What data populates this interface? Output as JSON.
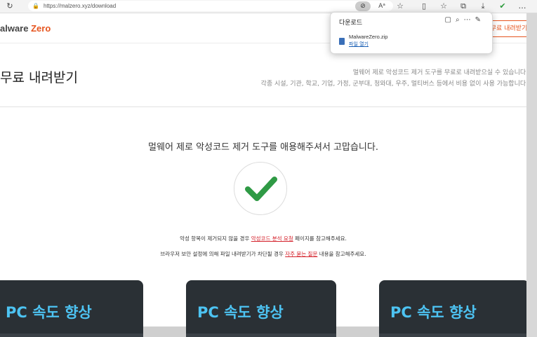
{
  "browser": {
    "url": "https://malzero.xyz/download",
    "icons": {
      "refresh": "refresh-icon",
      "lock": "lock-icon",
      "tracking": "eye-slash-icon",
      "read_aloud": "read-aloud-icon",
      "favorite": "star-icon",
      "split": "split-screen-icon",
      "favorites_list": "favorites-list-icon",
      "collections": "collections-icon",
      "downloads": "download-icon",
      "extension": "extension-icon",
      "more": "more-icon"
    }
  },
  "download_popup": {
    "title": "다운로드",
    "file_name": "MalwareZero.zip",
    "open_label": "파일 열기"
  },
  "site": {
    "logo_text_1": "alware",
    "logo_text_2": "Zero",
    "download_button": "무료 내려받기",
    "accent_color": "#e6551f"
  },
  "page": {
    "title": "무료 내려받기",
    "desc1": "멀웨어 제로 악성코드 제거 도구를 무료로 내려받으실 수 있습니다.",
    "desc2": "각종 시설, 기관, 학교, 기업, 가정, 군부대, 청와대, 우주, 멀티버스 등에서 비용 없이 사용 가능합니다.",
    "thanks": "멀웨어 제로 악성코드 제거 도구를 애용해주셔서 고맙습니다.",
    "note1_pre": "악성 항목이 제거되지 않을 경우 ",
    "note1_link": "악성코드 분석 요청",
    "note1_post": " 페이지를 참고해주세요.",
    "note2_pre": "브라우저 보안 설정에 의해 파일 내려받기가 차단될 경우 ",
    "note2_link": "자주 묻는 질문",
    "note2_post": " 내용을 참고해주세요."
  },
  "cards": [
    {
      "title": "PC 속도 향상"
    },
    {
      "title": "PC 속도 향상"
    },
    {
      "title": "PC 속도 향상"
    }
  ]
}
